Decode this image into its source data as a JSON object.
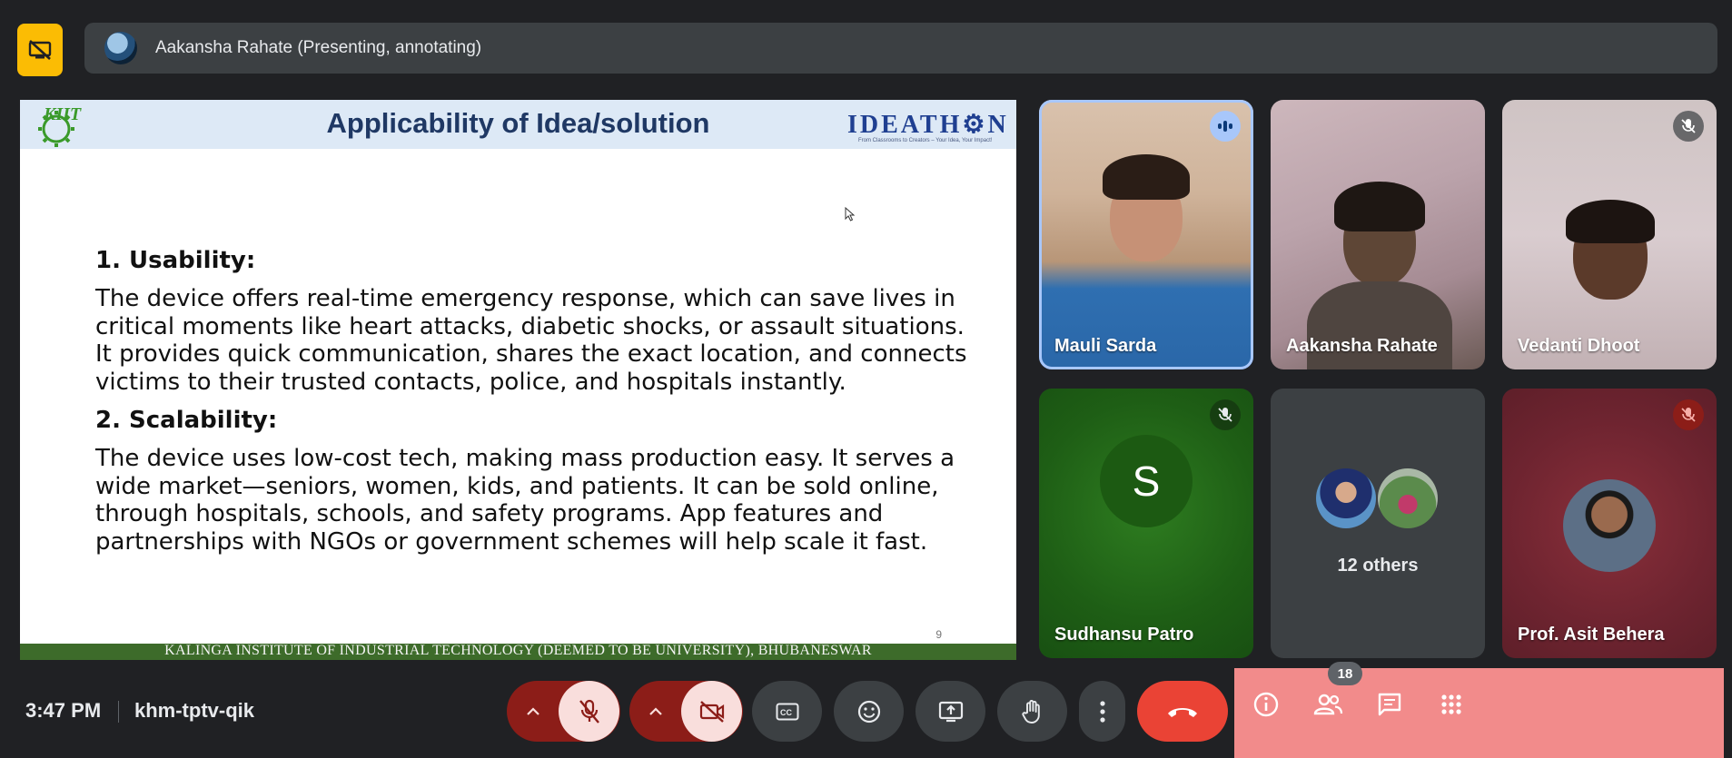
{
  "presenting_bar": {
    "title": "Aakansha Rahate (Presenting, annotating)"
  },
  "slide": {
    "title": "Applicability of Idea/solution",
    "kiit_logo_text": "KIIT",
    "ideathon_logo": "IDEATH⚙N",
    "ideathon_tagline": "From Classrooms to Creators – Your Idea, Your Impact!",
    "sections": [
      {
        "heading": "1. Usability:",
        "body": "The device offers real-time emergency response, which can save lives in critical moments like heart attacks, diabetic shocks, or assault situations. It provides quick communication, shares the exact location, and connects victims to their trusted contacts, police, and hospitals instantly."
      },
      {
        "heading": "2. Scalability:",
        "body": "The device uses low-cost tech, making mass production easy. It serves a wide market—seniors, women, kids, and patients. It can be sold online, through hospitals, schools, and safety programs. App features and partnerships with NGOs or government schemes will help scale it fast."
      }
    ],
    "page_number": "9",
    "footer": "KALINGA INSTITUTE OF INDUSTRIAL TECHNOLOGY (DEEMED TO BE UNIVERSITY), BHUBANESWAR"
  },
  "participants": [
    {
      "name": "Mauli Sarda",
      "state": "speaking"
    },
    {
      "name": "Aakansha Rahate",
      "state": "unmuted"
    },
    {
      "name": "Vedanti Dhoot",
      "state": "muted"
    },
    {
      "name": "Sudhansu Patro",
      "state": "muted",
      "initial": "S"
    },
    {
      "name": "12 others",
      "state": "group"
    },
    {
      "name": "Prof. Asit Behera",
      "state": "muted"
    }
  ],
  "footer_bar": {
    "time": "3:47 PM",
    "meeting_code": "khm-tptv-qik",
    "people_count": "18"
  },
  "colors": {
    "background": "#202124",
    "present_button": "#fbbc04",
    "hangup": "#ea4335",
    "muted_red": "#8c1d18",
    "panel_highlight": "#f28b8b"
  },
  "icons": [
    "stop-presenting-icon",
    "mic-off-icon",
    "camera-off-icon",
    "captions-icon",
    "emoji-icon",
    "present-icon",
    "raise-hand-icon",
    "more-options-icon",
    "hang-up-icon",
    "info-icon",
    "people-icon",
    "chat-icon",
    "activities-icon",
    "speaking-icon",
    "chevron-up-icon"
  ]
}
